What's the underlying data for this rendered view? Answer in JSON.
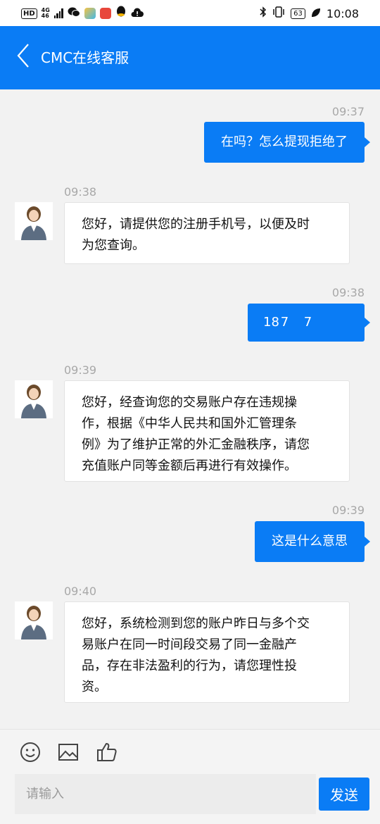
{
  "status_bar": {
    "hd": "HD",
    "net_top": "4G",
    "net_bottom": "46",
    "battery": "63",
    "time": "10:08"
  },
  "header": {
    "title": "CMC在线客服",
    "background": "#0a7cf5"
  },
  "messages": [
    {
      "time": "09:37",
      "side": "out",
      "text": "在吗？怎么提现拒绝了"
    },
    {
      "time": "09:38",
      "side": "in",
      "lines": [
        "您好，请提供您的注册手机号，以便及时",
        "为您查询。"
      ]
    },
    {
      "time": "09:38",
      "side": "out",
      "text": "18 7      7"
    },
    {
      "time": "09:39",
      "side": "in",
      "lines": [
        "您好，经查询您的交易账户存在违规操",
        "作，根据《中华人民共和国外汇管理条",
        "例》为了维护正常的外汇金融秩序，请您",
        "充值账户同等金额后再进行有效操作。"
      ]
    },
    {
      "time": "09:39",
      "side": "out",
      "text": "这是什么意思"
    },
    {
      "time": "09:40",
      "side": "in",
      "lines": [
        "您好，系统检测到您的账户昨日与多个交",
        "易账户在同一时间段交易了同一金融产",
        "品，存在非法盈利的行为，请您理性投",
        "资。"
      ]
    }
  ],
  "composer": {
    "icons": [
      "emoji-icon",
      "image-icon",
      "thumbs-up-icon"
    ],
    "placeholder": "请输入",
    "send_label": "发送"
  }
}
